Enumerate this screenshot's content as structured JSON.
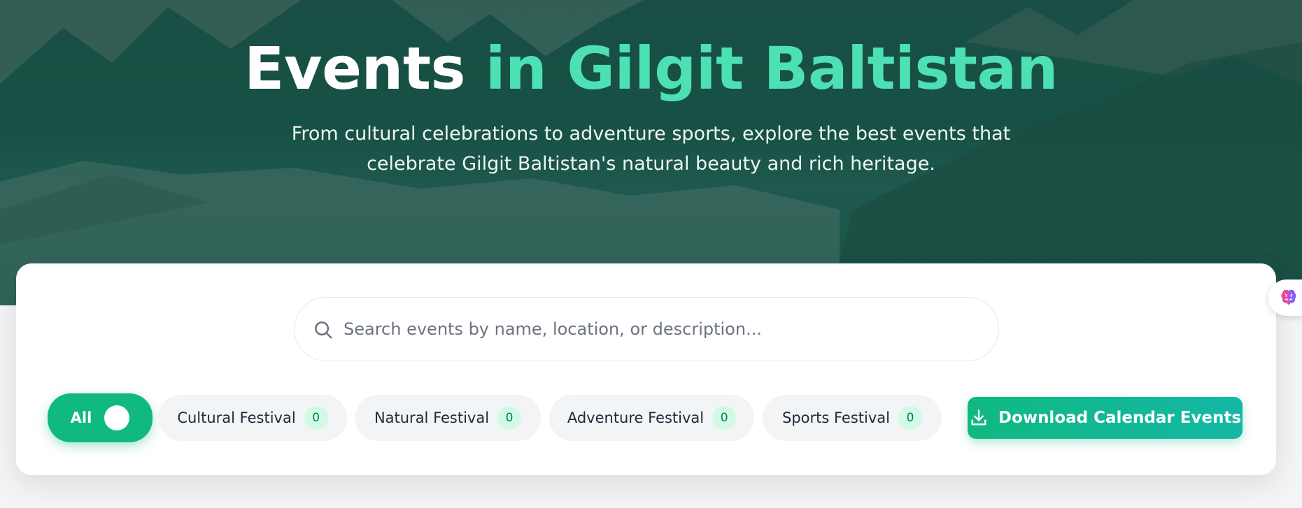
{
  "hero": {
    "title_plain": "Events",
    "title_accent": "in Gilgit Baltistan",
    "subtitle_line1": "From cultural celebrations to adventure sports, explore the best events that",
    "subtitle_line2": "celebrate Gilgit Baltistan's natural beauty and rich heritage."
  },
  "search": {
    "placeholder": "Search events by name, location, or description...",
    "value": "",
    "icon": "search-icon"
  },
  "filters": {
    "all_label": "All",
    "all_active": true,
    "items": [
      {
        "label": "Cultural Festival",
        "count": "0"
      },
      {
        "label": "Natural Festival",
        "count": "0"
      },
      {
        "label": "Adventure Festival",
        "count": "0"
      },
      {
        "label": "Sports Festival",
        "count": "0"
      }
    ]
  },
  "download_button": {
    "label": "Download Calendar Events",
    "icon": "download-icon"
  },
  "colors": {
    "accent": "#4de0b4",
    "primary": "#10b981",
    "hero_overlay": "#0c483e"
  }
}
